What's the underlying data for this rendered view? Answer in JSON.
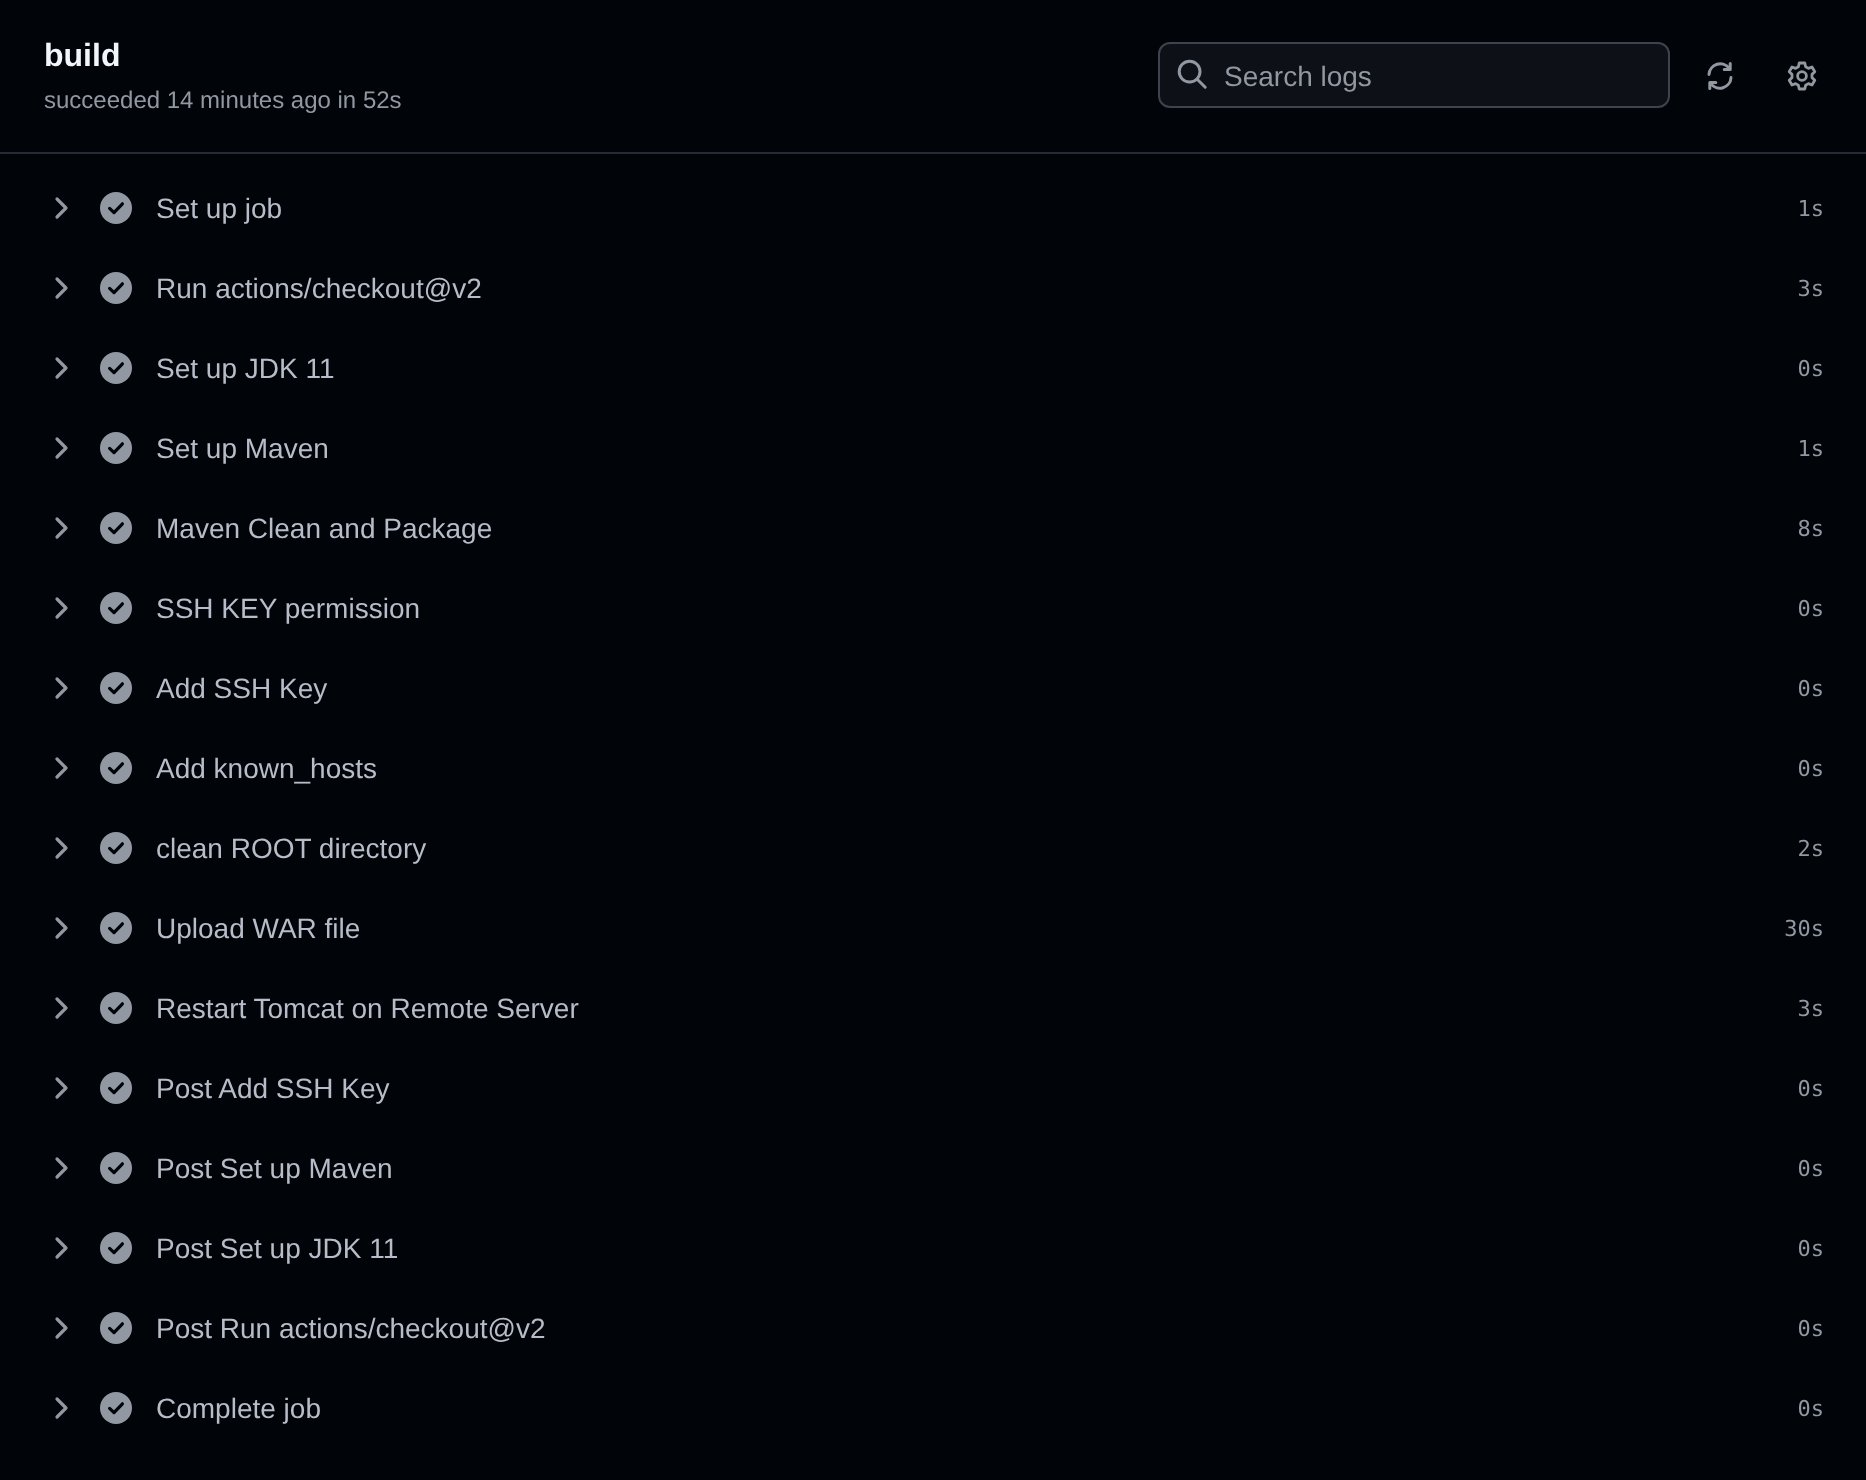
{
  "job": {
    "title": "build",
    "summary": "succeeded 14 minutes ago in 52s"
  },
  "search": {
    "placeholder": "Search logs"
  },
  "steps": [
    {
      "name": "Set up job",
      "duration": "1s",
      "passed": true,
      "expanded": false
    },
    {
      "name": "Run actions/checkout@v2",
      "duration": "3s",
      "passed": true,
      "expanded": false
    },
    {
      "name": "Set up JDK 11",
      "duration": "0s",
      "passed": true,
      "expanded": false
    },
    {
      "name": "Set up Maven",
      "duration": "1s",
      "passed": true,
      "expanded": false
    },
    {
      "name": "Maven Clean and Package",
      "duration": "8s",
      "passed": true,
      "expanded": false
    },
    {
      "name": "SSH KEY permission",
      "duration": "0s",
      "passed": true,
      "expanded": false
    },
    {
      "name": "Add SSH Key",
      "duration": "0s",
      "passed": true,
      "expanded": false
    },
    {
      "name": "Add known_hosts",
      "duration": "0s",
      "passed": true,
      "expanded": false
    },
    {
      "name": "clean ROOT directory",
      "duration": "2s",
      "passed": true,
      "expanded": false
    },
    {
      "name": "Upload WAR file",
      "duration": "30s",
      "passed": true,
      "expanded": false
    },
    {
      "name": "Restart Tomcat on Remote Server",
      "duration": "3s",
      "passed": true,
      "expanded": false
    },
    {
      "name": "Post Add SSH Key",
      "duration": "0s",
      "passed": true,
      "expanded": false
    },
    {
      "name": "Post Set up Maven",
      "duration": "0s",
      "passed": true,
      "expanded": false
    },
    {
      "name": "Post Set up JDK 11",
      "duration": "0s",
      "passed": true,
      "expanded": false
    },
    {
      "name": "Post Run actions/checkout@v2",
      "duration": "0s",
      "passed": true,
      "expanded": false
    },
    {
      "name": "Complete job",
      "duration": "0s",
      "passed": true,
      "expanded": false
    }
  ]
}
